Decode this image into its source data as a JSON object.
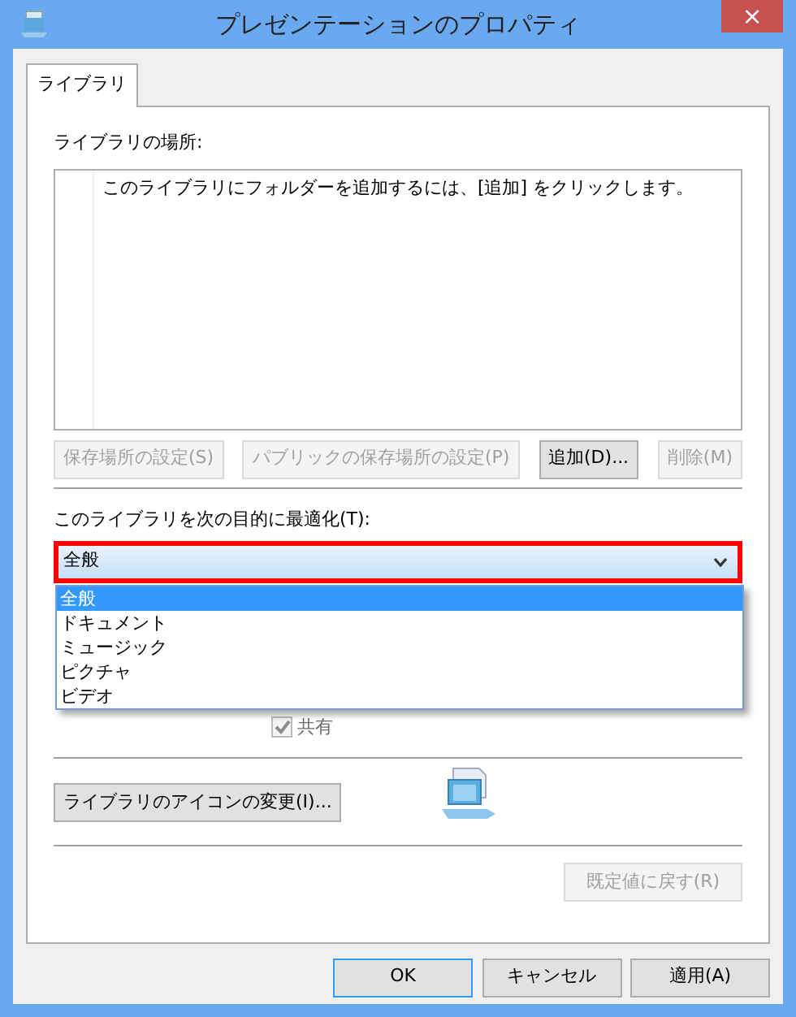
{
  "window": {
    "title": "プレゼンテーションのプロパティ",
    "close": "×"
  },
  "tabs": [
    {
      "label": "ライブラリ",
      "selected": true
    }
  ],
  "locations": {
    "label": "ライブラリの場所:",
    "empty_hint": "このライブラリにフォルダーを追加するには、[追加] をクリックします。"
  },
  "location_buttons": [
    {
      "label": "保存場所の設定(S)",
      "disabled": true
    },
    {
      "label": "パブリックの保存場所の設定(P)",
      "disabled": true
    },
    {
      "label": "追加(D)...",
      "disabled": false
    },
    {
      "label": "削除(M)",
      "disabled": true
    }
  ],
  "optimize": {
    "label": "このライブラリを次の目的に最適化(T):",
    "value": "全般",
    "annotation_highlight": true,
    "expanded": true,
    "options": [
      {
        "label": "全般",
        "selected": true
      },
      {
        "label": "ドキュメント",
        "selected": false
      },
      {
        "label": "ミュージック",
        "selected": false
      },
      {
        "label": "ピクチャ",
        "selected": false
      },
      {
        "label": "ビデオ",
        "selected": false
      }
    ]
  },
  "share_checkbox": {
    "label": "共有",
    "checked": true,
    "disabled": true
  },
  "icon_button": {
    "label": "ライブラリのアイコンの変更(I)..."
  },
  "restore_button": {
    "label": "既定値に戻す(R)",
    "disabled": true
  },
  "dialog_buttons": [
    {
      "label": "OK",
      "default": true
    },
    {
      "label": "キャンセル",
      "default": false
    },
    {
      "label": "適用(A)",
      "default": false
    }
  ]
}
